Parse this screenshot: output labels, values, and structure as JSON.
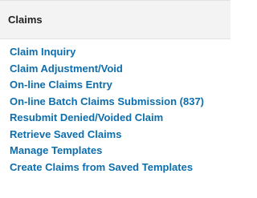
{
  "panel": {
    "title": "Claims",
    "accent_color": "#0d6ead",
    "items": [
      {
        "label": "Claim Inquiry"
      },
      {
        "label": "Claim Adjustment/Void"
      },
      {
        "label": "On-line Claims Entry"
      },
      {
        "label": "On-line Batch Claims Submission (837)"
      },
      {
        "label": "Resubmit Denied/Voided Claim"
      },
      {
        "label": "Retrieve Saved Claims"
      },
      {
        "label": "Manage Templates"
      },
      {
        "label": "Create Claims from Saved Templates"
      }
    ]
  }
}
